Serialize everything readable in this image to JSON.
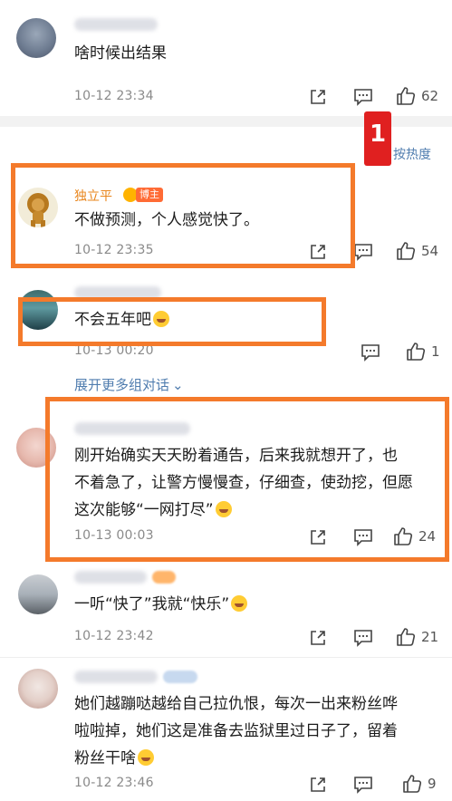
{
  "comments": [
    {
      "content": "啥时候出结果",
      "time": "10-12 23:34",
      "likes": "62"
    },
    {
      "username": "独立平",
      "badge": "博主",
      "content": "不做预测，个人感觉快了。",
      "time": "10-12 23:35",
      "likes": "54"
    },
    {
      "content": "不会五年吧",
      "time": "10-13 00:20",
      "likes": "1"
    },
    {
      "content_lines": [
        "刚开始确实天天盼着通告，后来我就想开了，也",
        "不着急了，让警方慢慢查，仔细查，使劲挖，但愿",
        "这次能够“一网打尽”"
      ],
      "time": "10-13 00:03",
      "likes": "24"
    },
    {
      "content": "一听“快了”我就“快乐”",
      "time": "10-12 23:42",
      "likes": "21"
    },
    {
      "content_lines": [
        "她们越蹦哒越给自己拉仇恨，每次一出来粉丝哗",
        "啦啦掉，她们这是准备去监狱里过日子了，留着",
        "粉丝干啥"
      ],
      "time": "10-12 23:46",
      "likes": "9"
    }
  ],
  "sort": {
    "marker": "1",
    "label": "按热度"
  },
  "expand_label": "展开更多组对话",
  "colors": {
    "accent": "#f47a2b",
    "link": "#507daf",
    "badge": "#ff6b35",
    "username": "#e8841a"
  }
}
